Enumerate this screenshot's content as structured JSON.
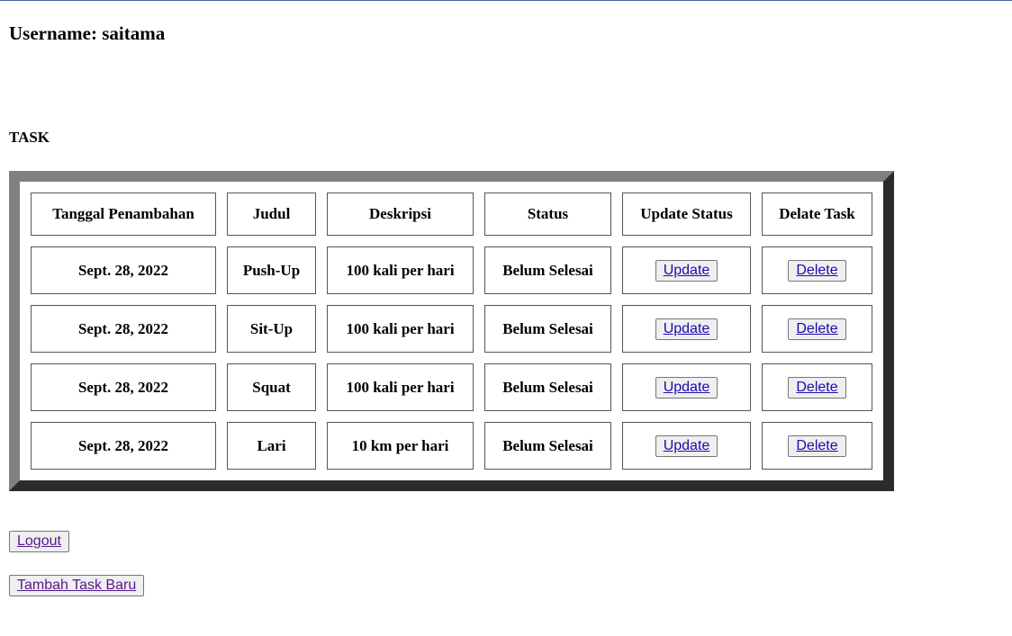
{
  "user": {
    "username_text": "Username: saitama"
  },
  "task_section": {
    "heading": "TASK"
  },
  "table": {
    "headers": [
      "Tanggal Penambahan",
      "Judul",
      "Deskripsi",
      "Status",
      "Update Status",
      "Delate Task"
    ],
    "rows": [
      {
        "date": "Sept. 28, 2022",
        "title": "Push-Up",
        "description": "100 kali per hari",
        "status": "Belum Selesai",
        "update_label": "Update",
        "delete_label": "Delete"
      },
      {
        "date": "Sept. 28, 2022",
        "title": "Sit-Up",
        "description": "100 kali per hari",
        "status": "Belum Selesai",
        "update_label": "Update",
        "delete_label": "Delete"
      },
      {
        "date": "Sept. 28, 2022",
        "title": "Squat",
        "description": "100 kali per hari",
        "status": "Belum Selesai",
        "update_label": "Update",
        "delete_label": "Delete"
      },
      {
        "date": "Sept. 28, 2022",
        "title": "Lari",
        "description": "10 km per hari",
        "status": "Belum Selesai",
        "update_label": "Update",
        "delete_label": "Delete"
      }
    ]
  },
  "actions": {
    "logout_label": "Logout",
    "add_task_label": "Tambah Task Baru"
  },
  "colors": {
    "link": "#1a0dab",
    "visited_link": "#551a8b",
    "border_light": "#808080",
    "border_dark": "#2b2b2b"
  }
}
